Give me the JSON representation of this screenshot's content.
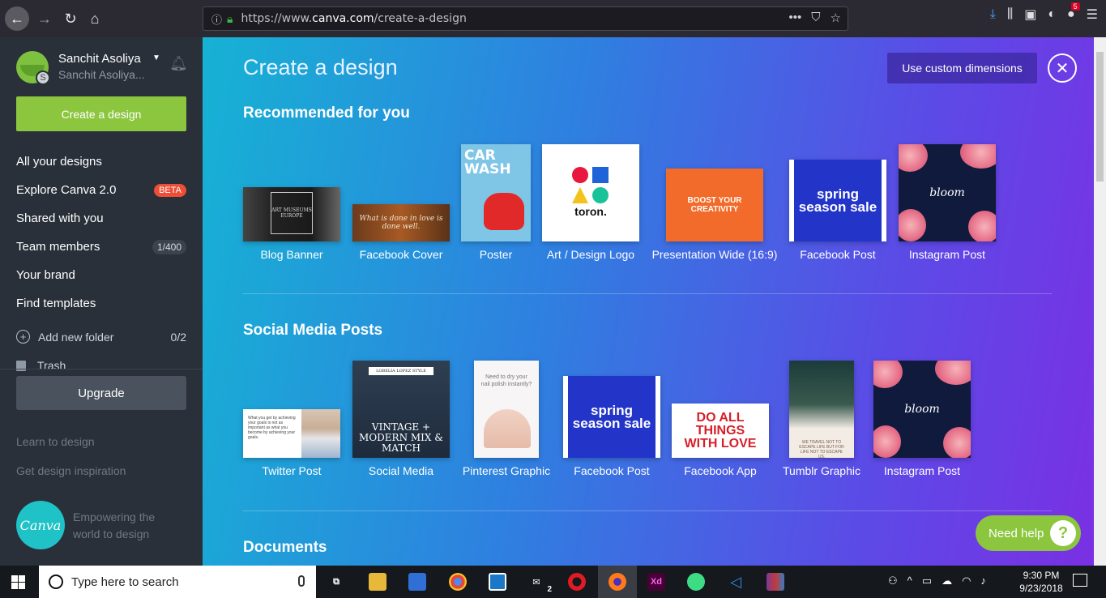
{
  "browser": {
    "url_prefix": "https://www.",
    "url_domain": "canva.com",
    "url_path": "/create-a-design",
    "tab_badge": "5"
  },
  "sidebar": {
    "user_name": "Sanchit Asoliya",
    "user_sub": "Sanchit Asoliya...",
    "avatar_initial": "S",
    "create_button": "Create a design",
    "items": [
      {
        "label": "All your designs"
      },
      {
        "label": "Explore Canva 2.0",
        "badge": "BETA"
      },
      {
        "label": "Shared with you"
      },
      {
        "label": "Team members",
        "count": "1/400"
      },
      {
        "label": "Your brand"
      },
      {
        "label": "Find templates"
      }
    ],
    "add_folder": "Add new folder",
    "folder_count": "0/2",
    "trash": "Trash",
    "upgrade": "Upgrade",
    "learn": "Learn to design",
    "inspiration": "Get design inspiration",
    "logo_text": "Canva",
    "tagline": "Empowering the world to design"
  },
  "main": {
    "title": "Create a design",
    "custom_dimensions": "Use custom dimensions",
    "sections": [
      {
        "title": "Recommended for you",
        "items": [
          {
            "label": "Blog Banner",
            "thumb_text": "ART MUSEUMS EUROPE"
          },
          {
            "label": "Facebook Cover",
            "thumb_text": "What is done in love is done well."
          },
          {
            "label": "Poster",
            "thumb_text": "CAR WASH"
          },
          {
            "label": "Art / Design Logo",
            "thumb_text": "toron."
          },
          {
            "label": "Presentation Wide (16:9)",
            "thumb_text": "BOOST YOUR CREATIVITY"
          },
          {
            "label": "Facebook Post",
            "thumb_text": "spring season sale"
          },
          {
            "label": "Instagram Post",
            "thumb_text": "bloom"
          }
        ]
      },
      {
        "title": "Social Media Posts",
        "items": [
          {
            "label": "Twitter Post",
            "thumb_text": "What you get by achieving your goals is not as important as what you become by achieving your goals."
          },
          {
            "label": "Social Media",
            "thumb_text": "VINTAGE + MODERN MIX & MATCH"
          },
          {
            "label": "Pinterest Graphic",
            "thumb_text": "Need to dry your nail polish instantly?"
          },
          {
            "label": "Facebook Post",
            "thumb_text": "spring season sale"
          },
          {
            "label": "Facebook App",
            "thumb_text": "DO ALL THINGS WITH LOVE"
          },
          {
            "label": "Tumblr Graphic",
            "thumb_text": "WE TRAVEL NOT TO ESCAPE LIFE BUT FOR LIFE NOT TO ESCAPE US."
          },
          {
            "label": "Instagram Post",
            "thumb_text": "bloom"
          }
        ]
      },
      {
        "title": "Documents",
        "items": []
      }
    ],
    "help": "Need help",
    "help_icon": "?"
  },
  "taskbar": {
    "search_placeholder": "Type here to search",
    "time": "9:30 PM",
    "date": "9/23/2018",
    "mail_badge": "2"
  },
  "colors": {
    "accent_green": "#8cc63f",
    "sidebar_bg": "#293039",
    "beta_badge": "#ee4d36",
    "gradient_start": "#16b2d4",
    "gradient_end": "#7a30e4"
  }
}
